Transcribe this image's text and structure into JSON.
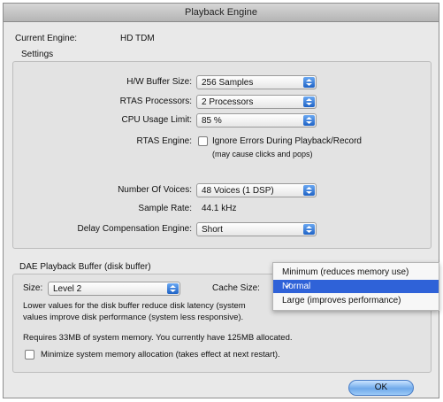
{
  "window": {
    "title": "Playback Engine"
  },
  "engine": {
    "label": "Current Engine:",
    "value": "HD TDM"
  },
  "settings": {
    "group_label": "Settings",
    "hw_buffer_size": {
      "label": "H/W Buffer Size:",
      "value": "256 Samples"
    },
    "rtas_processors": {
      "label": "RTAS Processors:",
      "value": "2 Processors"
    },
    "cpu_usage_limit": {
      "label": "CPU Usage Limit:",
      "value": "85 %"
    },
    "rtas_engine": {
      "label": "RTAS Engine:",
      "checkbox_label": "Ignore Errors During Playback/Record",
      "note": "(may cause clicks and pops)",
      "checked": false
    },
    "number_of_voices": {
      "label": "Number Of Voices:",
      "value": "48 Voices (1 DSP)"
    },
    "sample_rate": {
      "label": "Sample Rate:",
      "value": "44.1 kHz"
    },
    "delay_compensation": {
      "label": "Delay Compensation Engine:",
      "value": "Short"
    }
  },
  "dae": {
    "group_label": "DAE Playback Buffer (disk buffer)",
    "size": {
      "label": "Size:",
      "value": "Level 2"
    },
    "cache_size": {
      "label": "Cache Size:"
    },
    "description_line1": "Lower values for the disk buffer reduce disk latency (system",
    "description_line2": "values improve disk performance (system less responsive).",
    "memory_info": "Requires 33MB of system memory. You currently have 125MB allocated.",
    "minimize": {
      "label": "Minimize system memory allocation (takes effect at next restart).",
      "checked": false
    }
  },
  "cache_menu": {
    "options": [
      "Minimum (reduces memory use)",
      "Normal",
      "Large (improves performance)"
    ],
    "selected": "Normal",
    "check_glyph": "✓"
  },
  "buttons": {
    "ok": "OK"
  },
  "colors": {
    "accent": "#2f62d8",
    "window_bg": "#e9e9e9"
  },
  "icons": {
    "popup_arrows": "up-down-arrows-icon",
    "checkmark": "checkmark-icon"
  }
}
